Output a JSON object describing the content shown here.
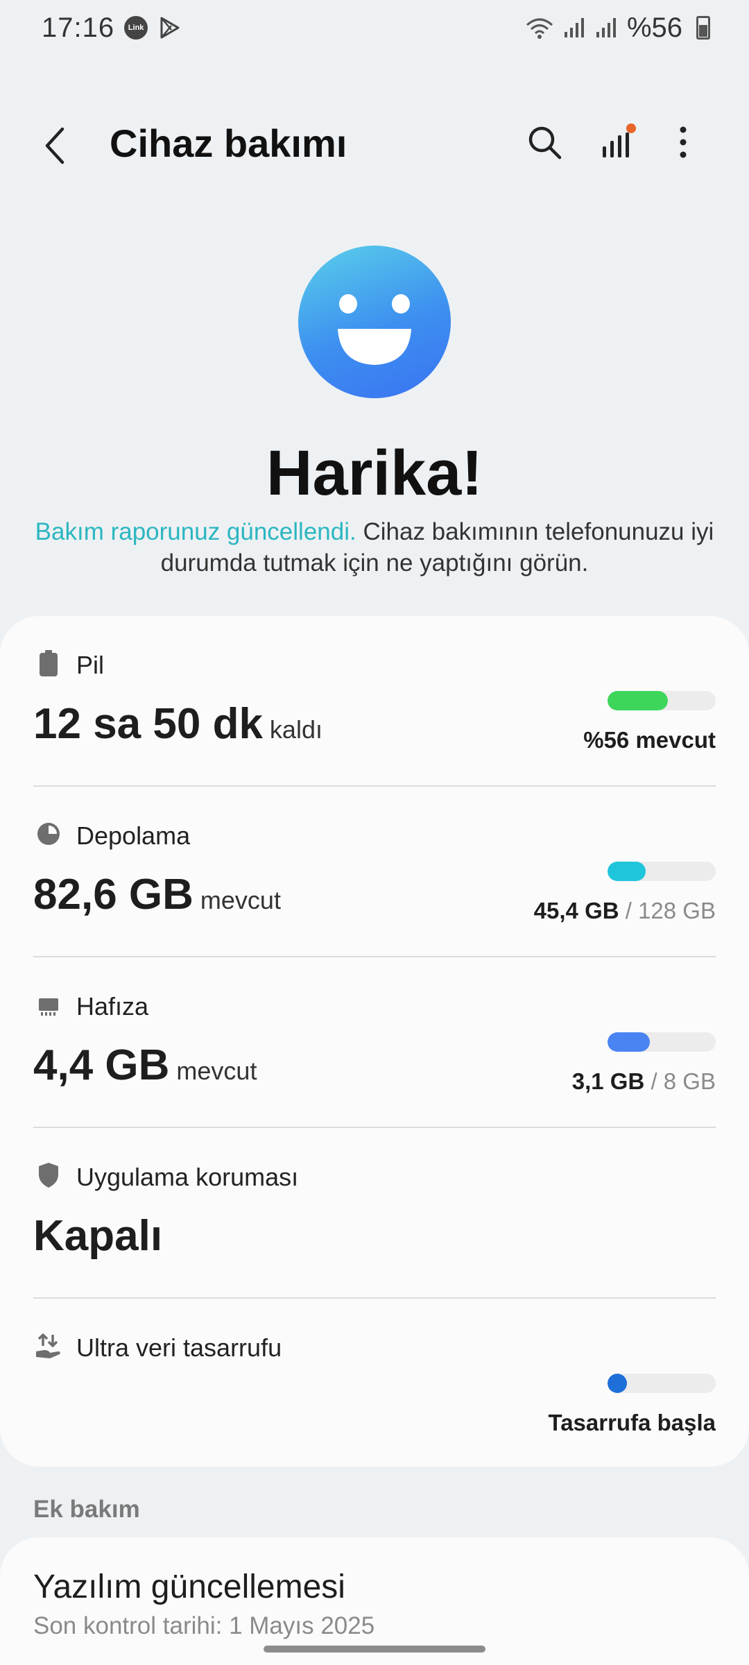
{
  "status_bar": {
    "time": "17:16",
    "notification_badge": "Link",
    "battery_text": "%56"
  },
  "header": {
    "title": "Cihaz bakımı",
    "icons": [
      "back-icon",
      "search-icon",
      "bar-chart-icon",
      "more-options-icon"
    ],
    "badge_color": "#e8652c"
  },
  "hero": {
    "headline": "Harika!",
    "sub_highlight": "Bakım raporunuz güncellendi.",
    "sub_rest": " Cihaz bakımının telefonunuzu iyi durumda tutmak için ne yaptığını görün.",
    "highlight_color": "#2bb6c1"
  },
  "items": [
    {
      "label": "Pil",
      "value": "12 sa 50 dk",
      "unit": "kaldı",
      "right_bold": "%56 mevcut",
      "right_muted": "",
      "fill": 0.56,
      "color": "#3dd65b",
      "icon": "battery-icon"
    },
    {
      "label": "Depolama",
      "value": "82,6 GB",
      "unit": "mevcut",
      "right_bold": "45,4 GB",
      "right_muted": " / 128 GB",
      "fill": 0.355,
      "color": "#1fc5db",
      "icon": "pie-chart-icon"
    },
    {
      "label": "Hafıza",
      "value": "4,4 GB",
      "unit": "mevcut",
      "right_bold": "3,1 GB",
      "right_muted": " / 8 GB",
      "fill": 0.39,
      "color": "#4a84f3",
      "icon": "memory-chip-icon"
    },
    {
      "label": "Uygulama koruması",
      "value": "Kapalı",
      "unit": "",
      "icon": "shield-icon"
    },
    {
      "label": "Ultra veri tasarrufu",
      "value": "",
      "unit": "",
      "right_bold": "Tasarrufa başla",
      "right_muted": "",
      "fill": 0.0,
      "color": "#1f6fd9",
      "icon": "data-saver-icon"
    }
  ],
  "extra": {
    "section_label": "Ek bakım",
    "software_update_title": "Yazılım güncellemesi",
    "software_update_sub": "Son kontrol tarihi: 1 Mayıs 2025"
  }
}
